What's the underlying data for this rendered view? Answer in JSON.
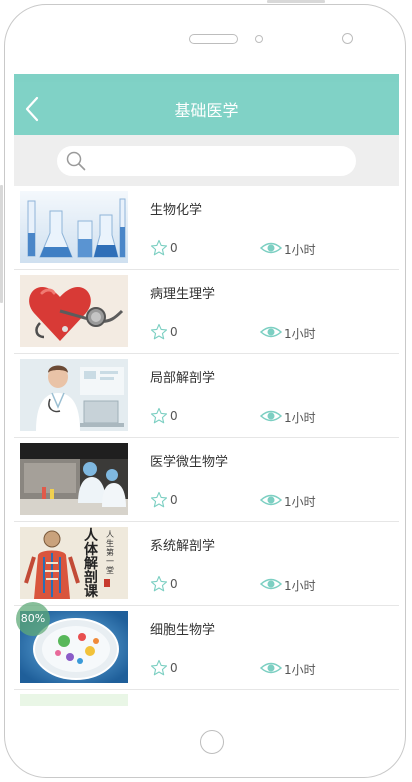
{
  "header": {
    "title": "基础医学"
  },
  "search": {
    "placeholder": "",
    "value": ""
  },
  "courses": [
    {
      "title": "生物化学",
      "stars": "0",
      "duration": "1小时",
      "thumb_icon": "lab-glassware-image"
    },
    {
      "title": "病理生理学",
      "stars": "0",
      "duration": "1小时",
      "thumb_icon": "heart-stethoscope-image"
    },
    {
      "title": "局部解剖学",
      "stars": "0",
      "duration": "1小时",
      "thumb_icon": "doctor-image"
    },
    {
      "title": "医学微生物学",
      "stars": "0",
      "duration": "1小时",
      "thumb_icon": "lab-workers-image"
    },
    {
      "title": "系统解剖学",
      "stars": "0",
      "duration": "1小时",
      "thumb_icon": "anatomy-image",
      "thumb_text": {
        "a": "人体解剖课",
        "b": "人生第一堂"
      }
    },
    {
      "title": "细胞生物学",
      "stars": "0",
      "duration": "1小时",
      "thumb_icon": "cell-dish-image",
      "progress": "80%"
    }
  ],
  "colors": {
    "accent": "#80d2c6",
    "search_bg": "#eeeeee",
    "divider": "#e6e6e6"
  }
}
